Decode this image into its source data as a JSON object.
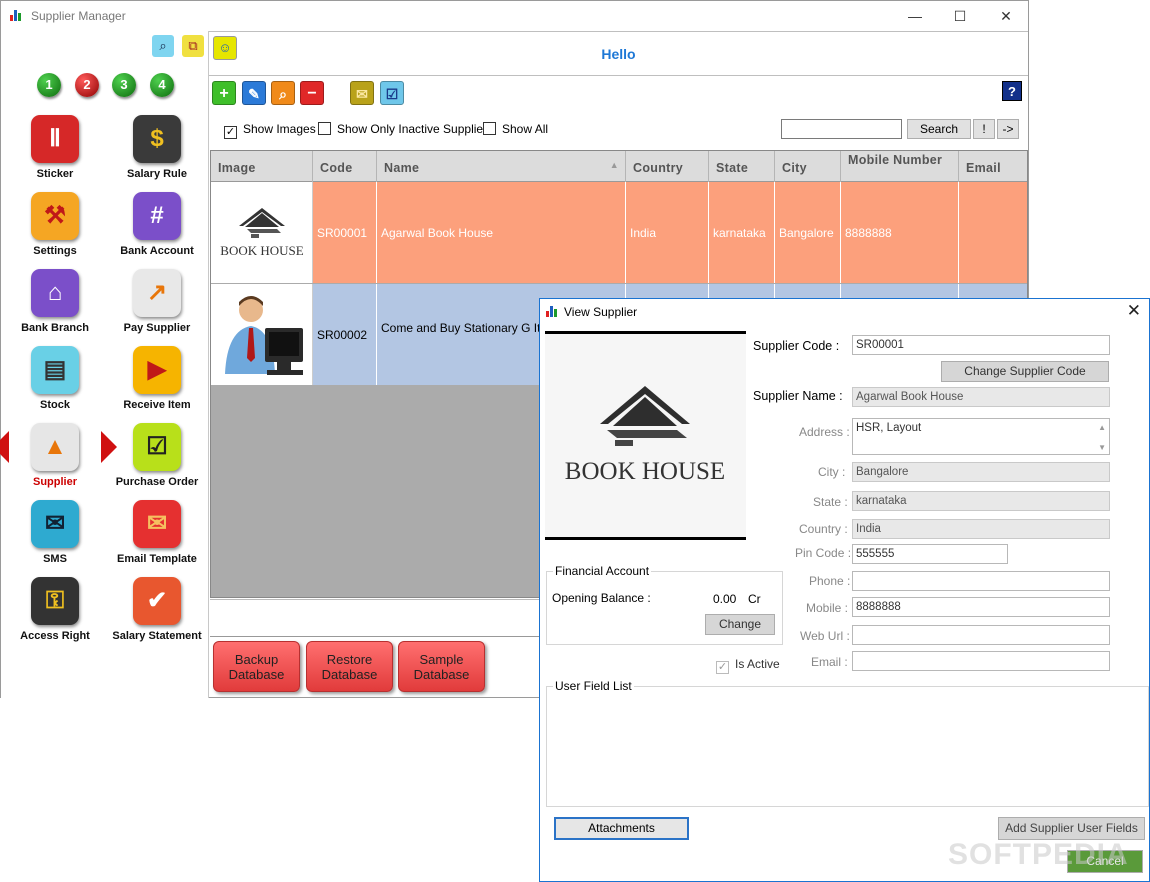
{
  "window": {
    "title": "Supplier Manager",
    "minimize": "—",
    "maximize": "☐",
    "close": "✕"
  },
  "sidebar": {
    "numbers": [
      "1",
      "2",
      "3",
      "4"
    ],
    "items": [
      {
        "label": "Sticker",
        "glyph": "▥",
        "color": "#d62828"
      },
      {
        "label": "Salary Rule",
        "glyph": "$",
        "color": "#3a3a3a"
      },
      {
        "label": "Settings",
        "glyph": "✎",
        "color": "#f5a623"
      },
      {
        "label": "Bank Account",
        "glyph": "#",
        "color": "#7b4fc9"
      },
      {
        "label": "Bank Branch",
        "glyph": "⌂",
        "color": "#7b4fc9"
      },
      {
        "label": "Pay Supplier",
        "glyph": "➚",
        "color": "#f0f0f0"
      },
      {
        "label": "Stock",
        "glyph": "▤",
        "color": "#69d0e6"
      },
      {
        "label": "Receive Item",
        "glyph": "▶",
        "color": "#f6b400"
      },
      {
        "label": "Supplier",
        "glyph": "▲",
        "color": "#e6e6e6"
      },
      {
        "label": "Purchase Order",
        "glyph": "☑",
        "color": "#b8e01a"
      },
      {
        "label": "SMS",
        "glyph": "✉",
        "color": "#2eaad0"
      },
      {
        "label": "Email Template",
        "glyph": "✉",
        "color": "#e53030"
      },
      {
        "label": "Access Right",
        "glyph": "⚿",
        "color": "#333333"
      },
      {
        "label": "Salary Statement",
        "glyph": "✔",
        "color": "#e8572f"
      }
    ]
  },
  "header": {
    "greeting": "Hello"
  },
  "toolbar": {
    "help": "?"
  },
  "options": {
    "show_images": "Show Images",
    "show_inactive": "Show Only Inactive Suppliers",
    "show_all": "Show All"
  },
  "search": {
    "value": "",
    "button": "Search",
    "btn_excl": "!",
    "btn_arrow": "->"
  },
  "grid": {
    "columns": [
      "Image",
      "Code",
      "Name",
      "Country",
      "State",
      "City",
      "Mobile Number",
      "Email"
    ],
    "rows": [
      {
        "code": "SR00001",
        "name": "Agarwal Book House",
        "country": "India",
        "state": "karnataka",
        "city": "Bangalore",
        "mobile": "8888888",
        "email": "",
        "logo_text": "BOOK HOUSE"
      },
      {
        "code": "SR00002",
        "name": "Come and Buy Stationary G Items",
        "country": "",
        "state": "",
        "city": "",
        "mobile": "",
        "email": ""
      }
    ]
  },
  "db_buttons": {
    "backup": "Backup Database",
    "restore": "Restore Database",
    "sample": "Sample Database"
  },
  "dialog": {
    "title": "View Supplier",
    "close": "✕",
    "logo_text": "BOOK HOUSE",
    "labels": {
      "code": "Supplier Code :",
      "name": "Supplier Name :",
      "address": "Address :",
      "city": "City :",
      "state": "State :",
      "country": "Country :",
      "pin": "Pin Code :",
      "phone": "Phone :",
      "mobile": "Mobile :",
      "web": "Web Url :",
      "email": "Email :"
    },
    "values": {
      "code": "SR00001",
      "name": "Agarwal Book House",
      "address": "HSR, Layout",
      "city": "Bangalore",
      "state": "karnataka",
      "country": "India",
      "pin": "555555",
      "phone": "",
      "mobile": "8888888",
      "web": "",
      "email": ""
    },
    "change_code_btn": "Change Supplier Code",
    "financial": {
      "title": "Financial Account",
      "label": "Opening Balance :",
      "amount": "0.00",
      "type": "Cr",
      "change_btn": "Change"
    },
    "is_active": "Is Active",
    "user_fields_title": "User Field List",
    "attachments_btn": "Attachments",
    "add_fields_btn": "Add Supplier User Fields",
    "cancel_btn": "Cancel"
  },
  "watermark": "SOFTPEDIA"
}
